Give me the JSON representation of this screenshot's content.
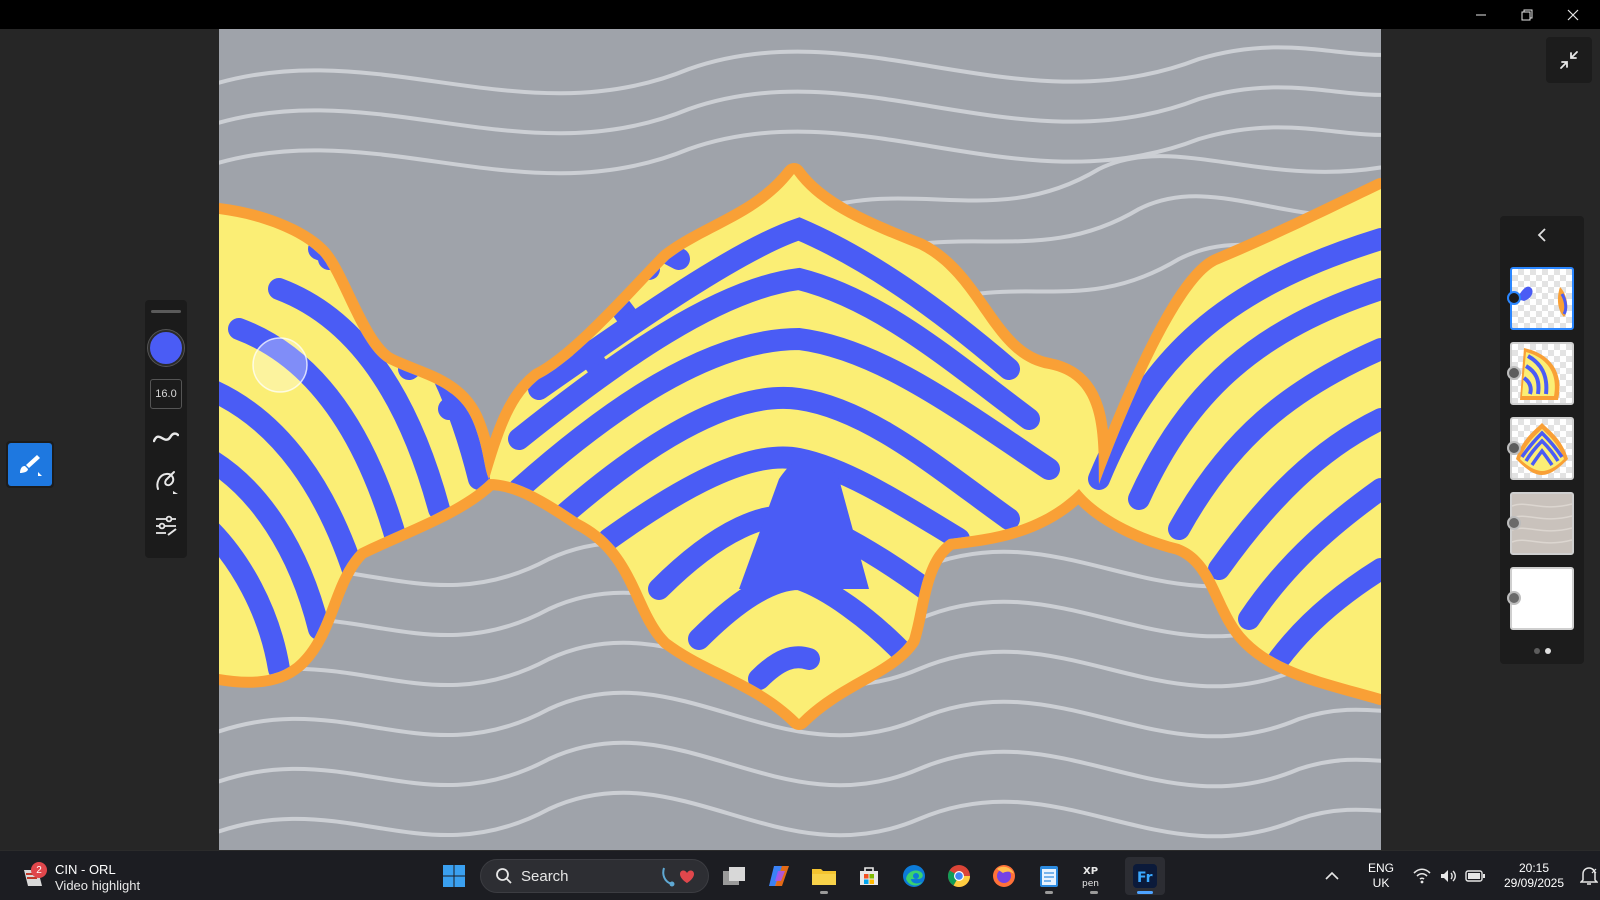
{
  "window": {
    "controls": {
      "minimize_icon": "minimize-icon",
      "restore_icon": "restore-icon",
      "close_icon": "close-icon"
    }
  },
  "toolbar": {
    "active_tool_icon": "paint-brush-icon",
    "brush_color": "#4a5cf5",
    "brush_size": "16.0",
    "icons": [
      "stroke-smoothing-icon",
      "brush-settings-icon",
      "brush-adjustments-icon"
    ]
  },
  "canvas": {
    "colors": {
      "background": "#9fa3aa",
      "line": "#d4d7dc",
      "blue": "#4a5cf5",
      "yellow": "#fbee75",
      "orange": "#f9a036"
    }
  },
  "layers": {
    "back_icon": "chevron-left-icon",
    "items": [
      {
        "type": "vector",
        "selected": true
      },
      {
        "type": "vector",
        "selected": false
      },
      {
        "type": "vector",
        "selected": false
      },
      {
        "type": "image",
        "selected": false
      },
      {
        "type": "image",
        "selected": false
      }
    ],
    "pages": 2,
    "current_page": 2
  },
  "taskbar": {
    "widget": {
      "badge": "2",
      "title": "CIN - ORL",
      "subtitle": "Video highlight"
    },
    "search_placeholder": "Search",
    "apps": [
      "start-icon",
      "task-view-icon",
      "copilot-icon",
      "file-explorer-icon",
      "microsoft-store-icon",
      "edge-icon",
      "chrome-icon",
      "firefox-icon",
      "notepad-icon",
      "xp-pen-icon",
      "fresco-icon"
    ],
    "tray": {
      "language": "ENG",
      "region": "UK",
      "time": "20:15",
      "date": "29/09/2025"
    }
  }
}
